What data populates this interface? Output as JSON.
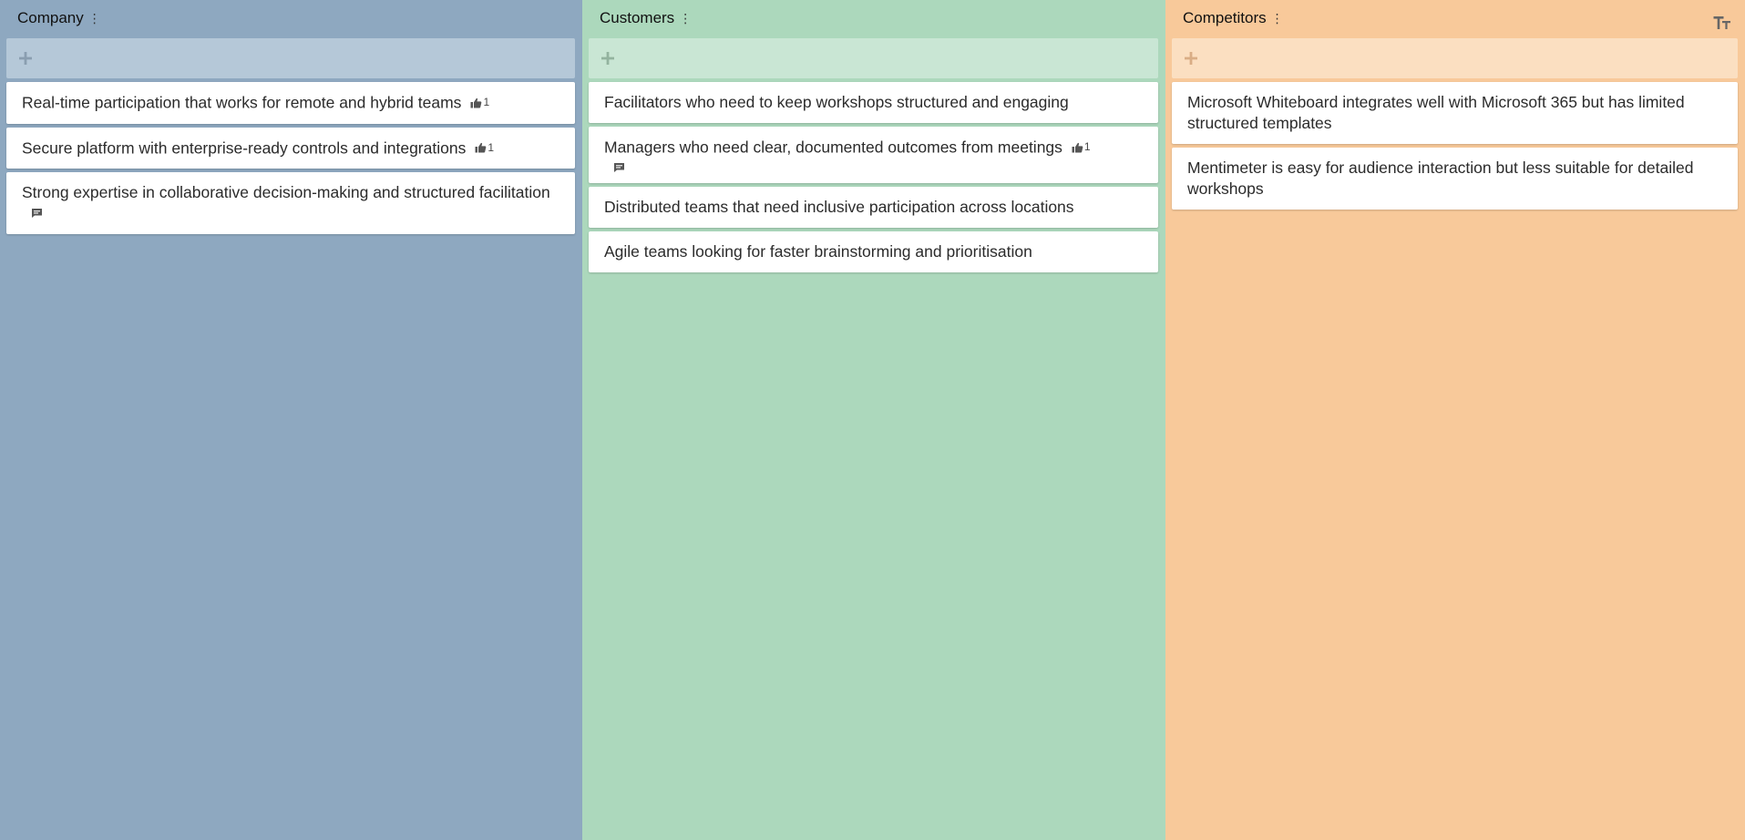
{
  "columns": [
    {
      "title": "Company",
      "cards": [
        {
          "text": "Real-time participation that works for remote and hybrid teams",
          "likes": "1",
          "comment": false
        },
        {
          "text": "Secure platform with enterprise-ready controls and integrations",
          "likes": "1",
          "comment": false
        },
        {
          "text": "Strong expertise in collaborative decision-making and structured facilitation",
          "likes": null,
          "comment": true
        }
      ]
    },
    {
      "title": "Customers",
      "cards": [
        {
          "text": "Facilitators who need to keep workshops structured and engaging",
          "likes": null,
          "comment": false
        },
        {
          "text": "Managers who need clear, documented outcomes from meetings",
          "likes": "1",
          "comment": true
        },
        {
          "text": "Distributed teams that need inclusive participation across locations",
          "likes": null,
          "comment": false
        },
        {
          "text": "Agile teams looking for faster brainstorming and prioritisation",
          "likes": null,
          "comment": false
        }
      ]
    },
    {
      "title": "Competitors",
      "cards": [
        {
          "text": "Microsoft Whiteboard integrates well with Microsoft 365 but has limited structured templates",
          "likes": null,
          "comment": false
        },
        {
          "text": "Mentimeter is easy for audience interaction but less suitable for detailed workshops",
          "likes": null,
          "comment": false
        }
      ]
    }
  ],
  "icons": {
    "add": "plus-icon",
    "like": "thumbs-up-icon",
    "comment": "comment-icon",
    "menu": "vertical-dots-icon",
    "font_size": "text-size-icon"
  },
  "colors": {
    "company_bg": "#8ea8c0",
    "customers_bg": "#acd8bc",
    "competitors_bg": "#f8c99a"
  }
}
